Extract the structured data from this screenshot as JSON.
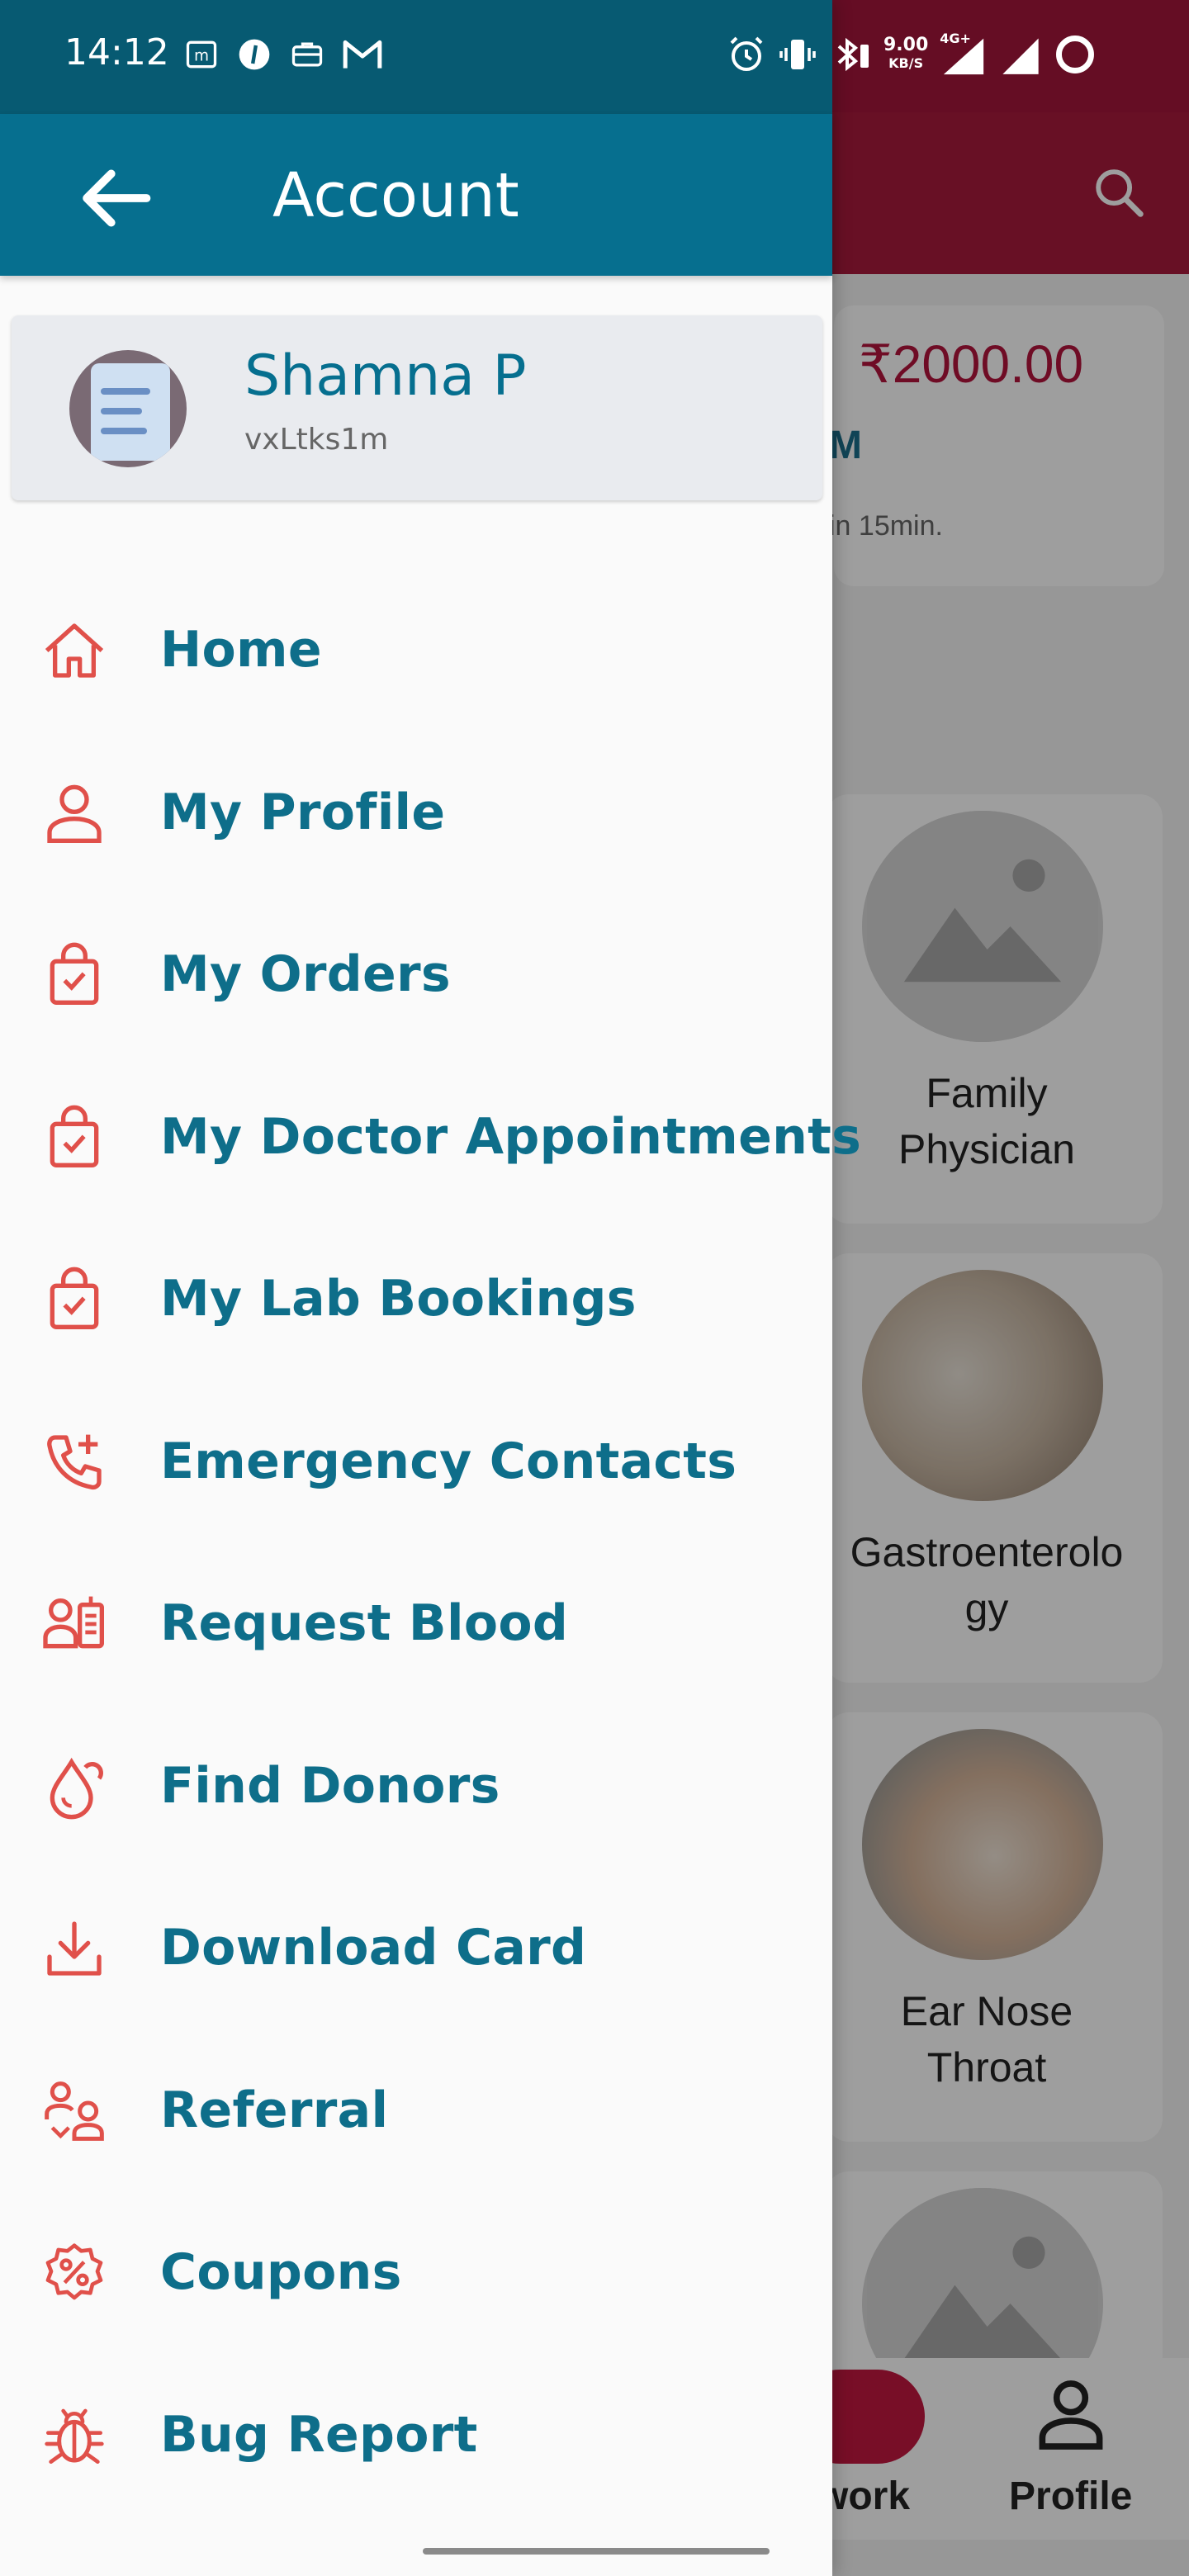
{
  "status_bar": {
    "time": "14:12",
    "net_speed": "9.00",
    "net_unit": "KB/S",
    "network_type": "4G+"
  },
  "app_bar": {
    "title": "Account",
    "back_icon": "arrow-left-icon"
  },
  "profile": {
    "name": "Shamna P",
    "user_id": "vxLtks1m"
  },
  "menu": [
    {
      "label": "Home",
      "icon": "home-icon"
    },
    {
      "label": "My Profile",
      "icon": "person-icon"
    },
    {
      "label": "My Orders",
      "icon": "shopping-bag-check-icon"
    },
    {
      "label": "My Doctor Appointments",
      "icon": "shopping-bag-check-icon"
    },
    {
      "label": "My Lab Bookings",
      "icon": "shopping-bag-check-icon"
    },
    {
      "label": "Emergency Contacts",
      "icon": "phone-plus-icon"
    },
    {
      "label": "Request Blood",
      "icon": "blood-request-icon"
    },
    {
      "label": "Find Donors",
      "icon": "blood-drop-icon"
    },
    {
      "label": "Download Card",
      "icon": "download-icon"
    },
    {
      "label": "Referral",
      "icon": "referral-icon"
    },
    {
      "label": "Coupons",
      "icon": "percent-badge-icon"
    },
    {
      "label": "Bug Report",
      "icon": "bug-icon"
    }
  ],
  "background": {
    "wallet_amount": "₹2000.00",
    "wallet_partial": "M",
    "wallet_note": "in 15min.",
    "cards": [
      {
        "label_line1": "Family",
        "label_line2": "Physician"
      },
      {
        "label_line1": "Gastroenterolo",
        "label_line2": "gy"
      },
      {
        "label_line1": "Ear Nose",
        "label_line2": "Throat"
      }
    ],
    "bottom_nav": {
      "network_label": "work",
      "profile_label": "Profile"
    }
  },
  "colors": {
    "primary": "#066f8f",
    "status_bar": "#075a72",
    "icon_accent": "#e0504a",
    "label_text": "#0e6e8a",
    "background_brand": "#a81a3d"
  }
}
